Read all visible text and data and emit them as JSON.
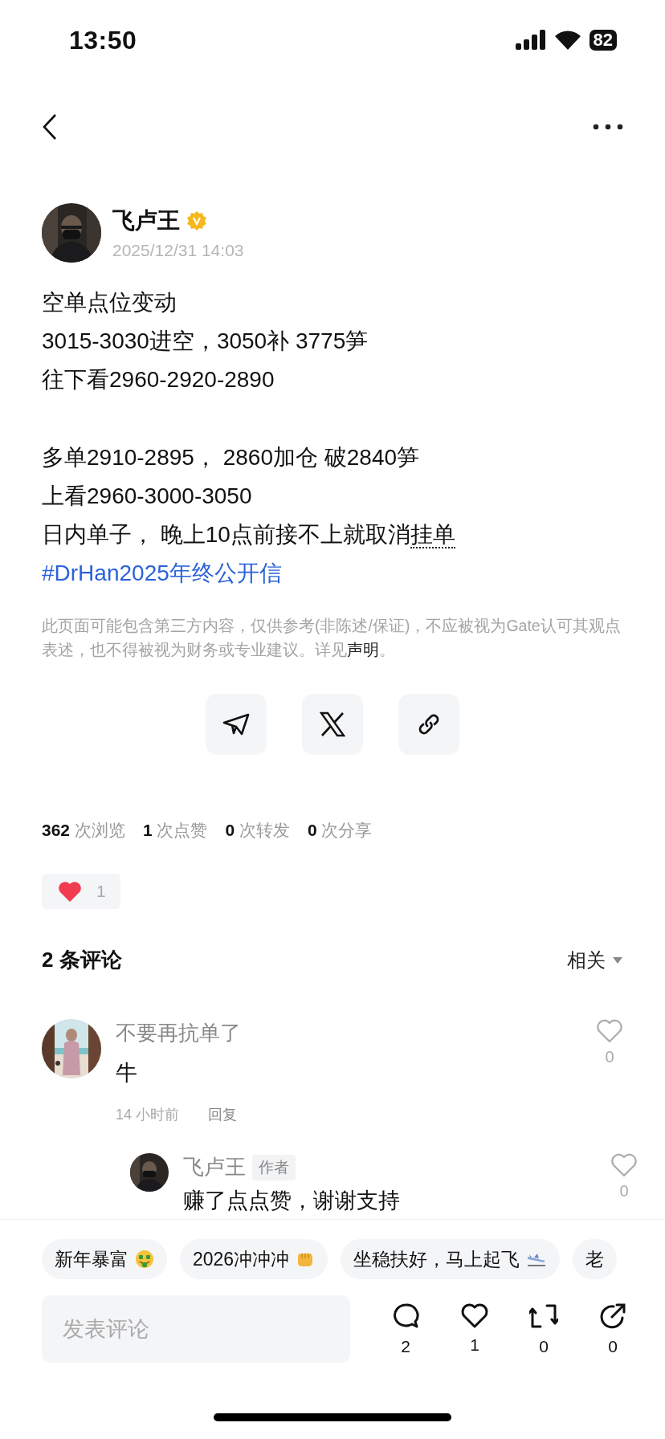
{
  "status_bar": {
    "time": "13:50",
    "battery": "82"
  },
  "author": {
    "name": "飞卢王",
    "verified": true,
    "date": "2025/12/31 14:03"
  },
  "post": {
    "paragraphs": [
      [
        [
          {
            "text": "空单点位变动",
            "underlined": false
          }
        ],
        [
          {
            "text": "3015-3030进空，3050补 3775笋",
            "underlined": false
          }
        ],
        [
          {
            "text": "往下看2960-2920-2890",
            "underlined": false
          }
        ]
      ],
      [
        [
          {
            "text": "多单2910-2895， 2860加仓  破2840笋",
            "underlined": false
          }
        ],
        [
          {
            "text": "上看2960-3000-3050",
            "underlined": false
          }
        ],
        [
          {
            "text": "日内单子， 晚上10点前接不上就取消",
            "underlined": false
          },
          {
            "text": "挂单",
            "underlined": true
          }
        ]
      ]
    ],
    "hashtag": "#DrHan2025年终公开信",
    "disclaimer": {
      "text": "此页面可能包含第三方内容，仅供参考(非陈述/保证)，不应被视为Gate认可其观点表述，也不得被视为财务或专业建议。详见",
      "link": "声明",
      "end": "。"
    }
  },
  "share_buttons": [
    {
      "kind": "telegram"
    },
    {
      "kind": "x"
    },
    {
      "kind": "link"
    }
  ],
  "stats": [
    {
      "count": "362",
      "unit": "次浏览"
    },
    {
      "count": "1",
      "unit": "次点赞"
    },
    {
      "count": "0",
      "unit": "次转发"
    },
    {
      "count": "0",
      "unit": "次分享"
    }
  ],
  "reactions": [
    {
      "kind": "heart",
      "count": "1"
    }
  ],
  "comments": {
    "title": "2 条评论",
    "sort": "相关",
    "items": [
      {
        "name": "不要再抗单了",
        "text": "牛",
        "time": "14 小时前",
        "reply": "回复",
        "likes": "0",
        "replies": [
          {
            "name": "飞卢王",
            "badge": "作者",
            "text": "赚了点点赞，谢谢支持",
            "likes": "0"
          }
        ]
      }
    ]
  },
  "topic_chips": [
    {
      "label": "新年暴富",
      "kind": "money-face"
    },
    {
      "label": "2026冲冲冲",
      "kind": "fist"
    },
    {
      "label": "坐稳扶好，马上起飞",
      "kind": "plane"
    },
    {
      "label": "老",
      "kind": "plain"
    }
  ],
  "comment_input": {
    "placeholder": "发表评论"
  },
  "actions": [
    {
      "kind": "comment",
      "count": "2"
    },
    {
      "kind": "like",
      "count": "1"
    },
    {
      "kind": "repost",
      "count": "0"
    },
    {
      "kind": "share",
      "count": "0"
    }
  ]
}
